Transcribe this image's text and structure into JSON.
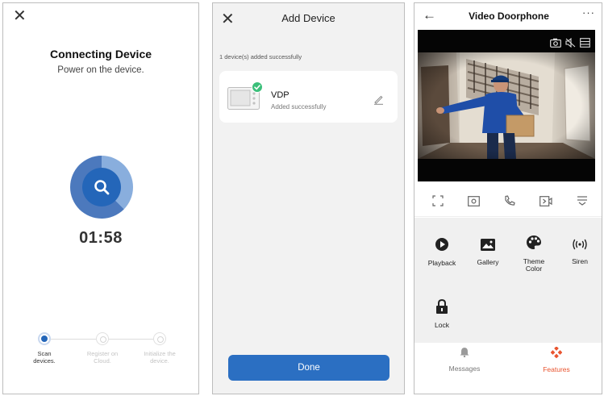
{
  "connecting_screen": {
    "close_icon": "close-icon",
    "title": "Connecting Device",
    "subtitle": "Power on the device.",
    "search_icon": "search-icon",
    "timer": "01:58",
    "progress_color": "#2466b9",
    "steps": [
      {
        "label_line1": "Scan",
        "label_line2": "devices.",
        "state": "active"
      },
      {
        "label_line1": "Register on",
        "label_line2": "Cloud.",
        "state": "pending"
      },
      {
        "label_line1": "Initialize the",
        "label_line2": "device.",
        "state": "pending"
      }
    ]
  },
  "add_device_screen": {
    "close_icon": "close-icon",
    "title": "Add Device",
    "note": "1 device(s) added successfully",
    "device": {
      "name": "VDP",
      "status": "Added successfully",
      "thumbnail_icon": "indoor-monitor-icon",
      "check_badge": "check-icon",
      "edit_icon": "edit-pencil-icon"
    },
    "done_label": "Done",
    "accent": "#2b6fc2"
  },
  "doorphone_screen": {
    "back_icon": "back-arrow-icon",
    "title": "Video Doorphone",
    "more_icon": "more-icon",
    "video_overlay_icons": [
      "snapshot-icon",
      "mute-icon",
      "sd-card-icon"
    ],
    "video_content": "courier-holding-package-image",
    "controls": [
      {
        "icon": "fullscreen-icon"
      },
      {
        "icon": "screenshot-icon"
      },
      {
        "icon": "phone-icon"
      },
      {
        "icon": "record-icon"
      },
      {
        "icon": "collapse-icon"
      }
    ],
    "features": [
      {
        "label": "Playback",
        "label_line2": "",
        "icon": "playback-icon"
      },
      {
        "label": "Gallery",
        "label_line2": "",
        "icon": "gallery-icon"
      },
      {
        "label": "Theme",
        "label_line2": "Color",
        "icon": "palette-icon"
      },
      {
        "label": "Siren",
        "label_line2": "",
        "icon": "siren-icon"
      },
      {
        "label": "Lock",
        "label_line2": "",
        "icon": "lock-icon"
      }
    ],
    "nav": [
      {
        "label": "Messages",
        "icon": "bell-icon",
        "active": false
      },
      {
        "label": "Features",
        "icon": "features-icon",
        "active": true
      }
    ],
    "active_color": "#e9542f"
  }
}
